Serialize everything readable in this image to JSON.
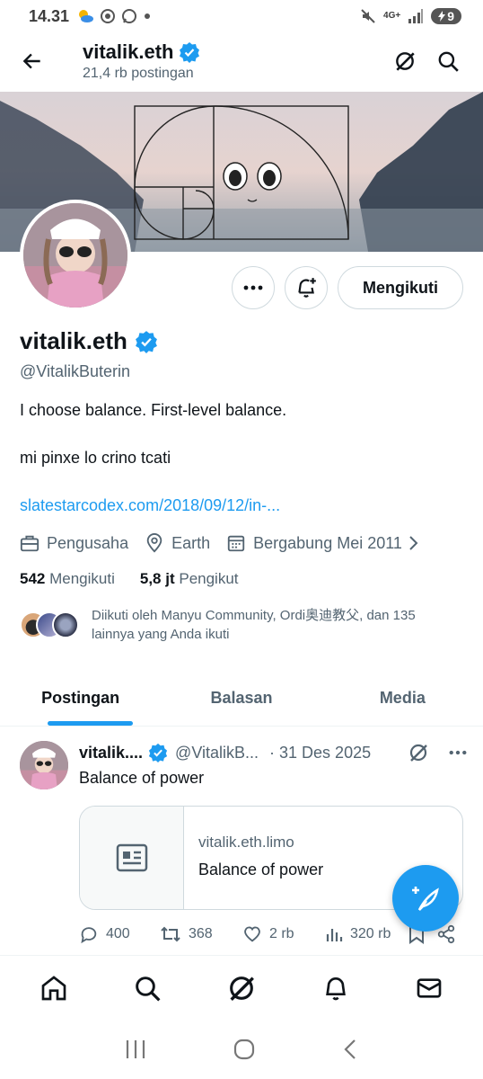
{
  "status_bar": {
    "time": "14.31",
    "network": "4G+",
    "battery": "9"
  },
  "header": {
    "title": "vitalik.eth",
    "subtitle": "21,4 rb postingan"
  },
  "profile": {
    "display_name": "vitalik.eth",
    "handle": "@VitalikButerin",
    "bio_line1": "I choose balance. First-level balance.",
    "bio_line2": "mi pinxe lo crino tcati",
    "link": "slatestarcodex.com/2018/09/12/in-...",
    "category": "Pengusaha",
    "location": "Earth",
    "joined": "Bergabung Mei 2011",
    "following_count": "542",
    "following_label": "Mengikuti",
    "followers_count": "5,8 jt",
    "followers_label": "Pengikut",
    "followed_by": "Diikuti oleh Manyu Community, Ordi奥迪教父, dan 135 lainnya yang Anda ikuti",
    "follow_button": "Mengikuti"
  },
  "tabs": [
    {
      "label": "Postingan",
      "active": true
    },
    {
      "label": "Balasan",
      "active": false
    },
    {
      "label": "Media",
      "active": false
    }
  ],
  "post": {
    "name": "vitalik....",
    "handle": "@VitalikB...",
    "date": "· 31 Des 2025",
    "text": "Balance of power",
    "card_domain": "vitalik.eth.limo",
    "card_title": "Balance of power",
    "replies": "400",
    "reposts": "368",
    "likes": "2 rb",
    "views": "320 rb"
  },
  "colors": {
    "accent": "#1d9bf0",
    "text": "#0f1419",
    "secondary": "#536471",
    "border": "#cfd9de"
  }
}
